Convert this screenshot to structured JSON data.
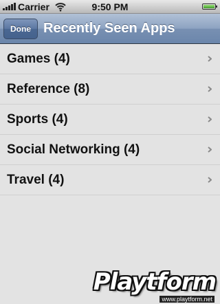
{
  "status_bar": {
    "carrier": "Carrier",
    "time": "9:50 PM",
    "icons": [
      "signal-icon",
      "wifi-icon",
      "battery-icon"
    ]
  },
  "nav": {
    "done_label": "Done",
    "title": "Recently Seen Apps"
  },
  "list": {
    "items": [
      {
        "label": "Games (4)"
      },
      {
        "label": "Reference (8)"
      },
      {
        "label": "Sports (4)"
      },
      {
        "label": "Social Networking (4)"
      },
      {
        "label": "Travel (4)"
      }
    ]
  },
  "watermark": {
    "logo": "Playtform",
    "url": "www.playtform.net"
  },
  "colors": {
    "nav_bar": "#6b86ab",
    "background": "#e3e3e3",
    "separator": "#cfcfcf",
    "chevron": "#8a8a8a"
  }
}
